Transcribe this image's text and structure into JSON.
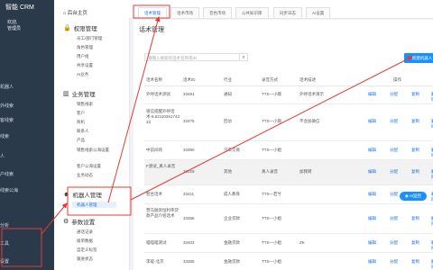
{
  "app": {
    "logo_text": "智能 CRM",
    "welcome": "欢迎,",
    "user": "管理员"
  },
  "dark_sidebar": {
    "items": [
      "机器人",
      "外线索",
      "客线索",
      "线索",
      "人",
      "户线索",
      "线索公海",
      "分析",
      "工具",
      "设置"
    ]
  },
  "submenu": {
    "home": "后台主页",
    "groups": [
      {
        "label": "权限管理",
        "items": [
          "员工/部门管理",
          "角色管理",
          "用户组",
          "共享设置",
          "AI业务"
        ]
      },
      {
        "label": "业务管理",
        "items": [
          "销售线索",
          "客户",
          "商机",
          "联系人",
          "产品",
          "销售线索公海设置",
          "客户公海设置",
          "业务动态"
        ]
      },
      {
        "label": "机器人管理",
        "items": [
          "机器人管理"
        ]
      },
      {
        "label": "参数设置",
        "items": [
          "通话记录",
          "级单数据",
          "自定义标签",
          "跟进状态"
        ]
      }
    ]
  },
  "tabs": [
    "话术管理",
    "话术市场",
    "音色市场",
    "公共知识库",
    "同步日志",
    "AI设置"
  ],
  "main": {
    "title": "话术管理",
    "search_placeholder": "请输入搜索的话术名称或ID",
    "search_icon": "search-icon",
    "new_button": "新建机器人",
    "columns": [
      "话术名称",
      "话术ID",
      "行业",
      "录音方式",
      "话术描述",
      "操作"
    ],
    "rows": [
      {
        "name": "外呼话术测试",
        "id": "33481",
        "industry": "通知",
        "record": "TTS—小薇",
        "desc": "外呼话术演示",
        "ops": [
          "编辑",
          "分配",
          "复制",
          "删除"
        ]
      },
      {
        "name": "锁信提醒外呼话术-8.62110261743 33",
        "id": "33475",
        "industry": "回访",
        "record": "TTS—小薇",
        "desc": "不含加微信",
        "ops": [
          "编辑",
          "分配",
          "复制",
          "删除"
        ]
      },
      {
        "name": "中前间场",
        "id": "33390",
        "industry": "汽车交易",
        "record": "TTS—小姐",
        "desc": "",
        "ops": [
          "编辑",
          "分配",
          "复制",
          "删除"
        ]
      },
      {
        "name": "F测试_真人录音",
        "id": "32029",
        "industry": "其他",
        "record": "真人录音",
        "desc": "加我转",
        "ops": [
          "编辑",
          "分配",
          "复制",
          "删除"
        ]
      },
      {
        "name": "智合话术",
        "id": "33411",
        "industry": "成人教育",
        "record": "TTS—若兮",
        "desc": "",
        "ops": [
          "编辑",
          "分配",
          "复制",
          "删除"
        ]
      },
      {
        "name": "营马融资恒利率贷款产品介绍话术",
        "id": "33396",
        "industry": "企业贷款",
        "record": "TTS—小姐",
        "desc": "",
        "ops": [
          "编辑",
          "分配",
          "复制",
          "删除"
        ]
      },
      {
        "name": "喵喵喵测试",
        "id": "33403",
        "industry": "金融贷款",
        "record": "TTS—小姐",
        "desc": "ZK",
        "ops": [
          "编辑",
          "分配",
          "复制",
          "删除"
        ]
      },
      {
        "name": "李磋-北京",
        "id": "33385",
        "industry": "金融贷款",
        "record": "TTS—小姐",
        "desc": "",
        "ops": [
          "编辑",
          "分配",
          "复制",
          "删除"
        ]
      }
    ]
  },
  "ai_assistant_button": "AI监控",
  "colors": {
    "sidebar_dark": "#2b3a4b",
    "accent": "#1890ff",
    "annotation_red": "#e53935"
  }
}
